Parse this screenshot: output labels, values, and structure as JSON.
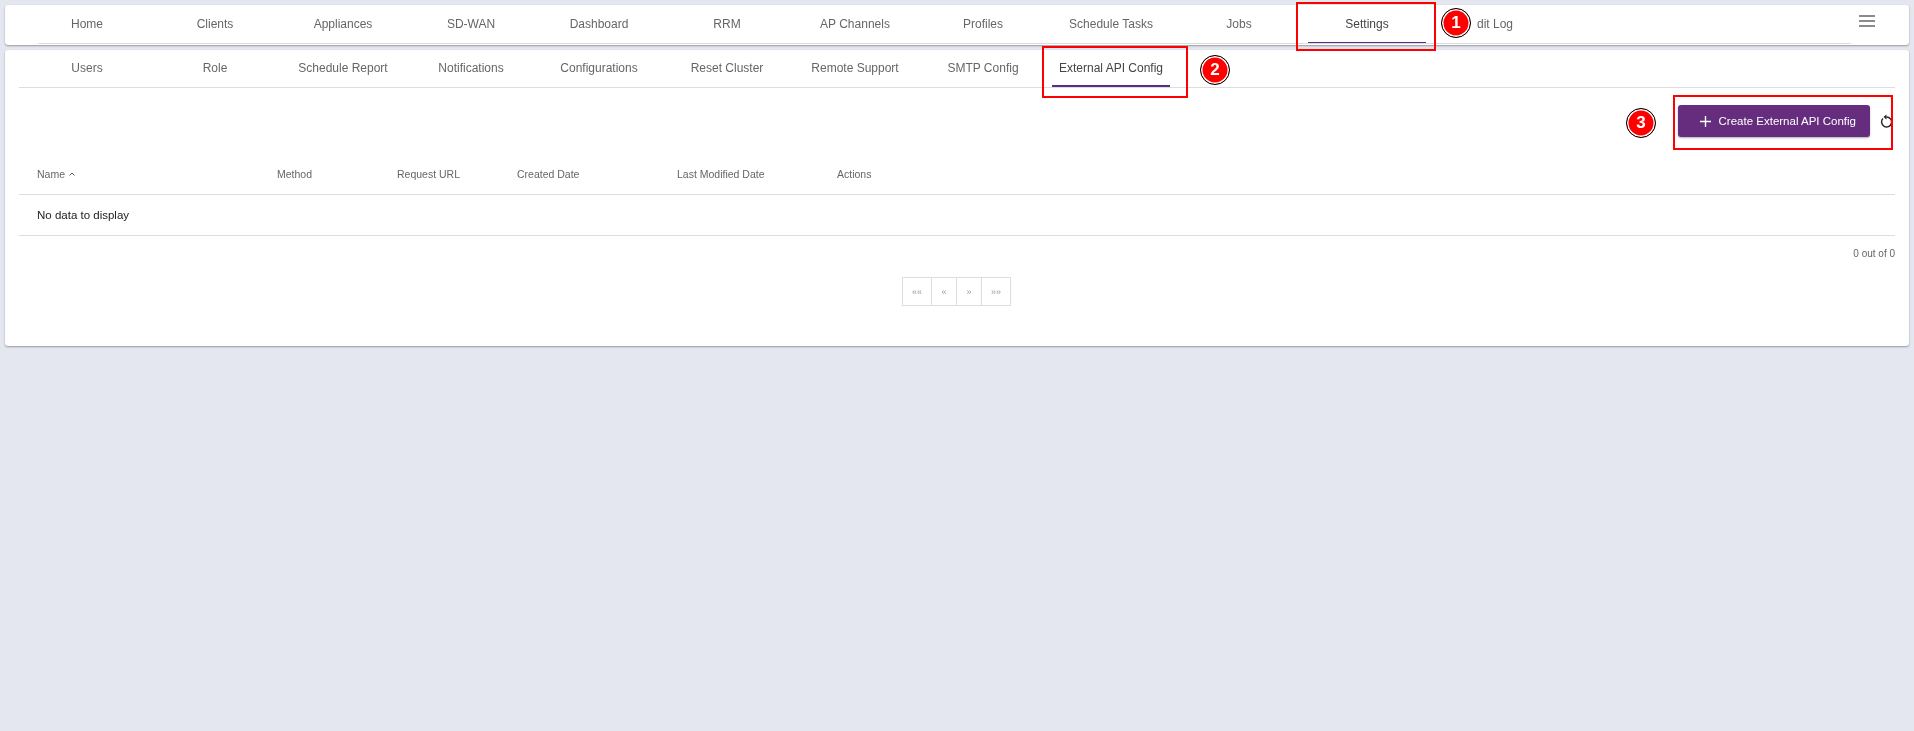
{
  "main_nav": {
    "tabs": [
      {
        "label": "Home",
        "selected": false
      },
      {
        "label": "Clients",
        "selected": false
      },
      {
        "label": "Appliances",
        "selected": false
      },
      {
        "label": "SD-WAN",
        "selected": false
      },
      {
        "label": "Dashboard",
        "selected": false
      },
      {
        "label": "RRM",
        "selected": false
      },
      {
        "label": "AP Channels",
        "selected": false
      },
      {
        "label": "Profiles",
        "selected": false
      },
      {
        "label": "Schedule Tasks",
        "selected": false
      },
      {
        "label": "Jobs",
        "selected": false
      },
      {
        "label": "Settings",
        "selected": true
      },
      {
        "label": "dit Log",
        "selected": false
      }
    ]
  },
  "settings_tabs": [
    {
      "label": "Users",
      "selected": false
    },
    {
      "label": "Role",
      "selected": false
    },
    {
      "label": "Schedule Report",
      "selected": false
    },
    {
      "label": "Notifications",
      "selected": false
    },
    {
      "label": "Configurations",
      "selected": false
    },
    {
      "label": "Reset Cluster",
      "selected": false
    },
    {
      "label": "Remote Support",
      "selected": false
    },
    {
      "label": "SMTP Config",
      "selected": false
    },
    {
      "label": "External API Config",
      "selected": true
    }
  ],
  "create_button": {
    "label": "Create External API Config"
  },
  "table": {
    "columns": [
      {
        "label": "Name",
        "sorted_ascending": true
      },
      {
        "label": "Method"
      },
      {
        "label": "Request URL"
      },
      {
        "label": "Created Date"
      },
      {
        "label": "Last Modified Date"
      },
      {
        "label": "Actions"
      }
    ],
    "empty_message": "No data to display"
  },
  "record_count": "0 out of 0",
  "pagination": [
    "««",
    "«",
    "»",
    "»»"
  ],
  "callouts": [
    {
      "label": "1"
    },
    {
      "label": "2"
    },
    {
      "label": "3"
    }
  ]
}
